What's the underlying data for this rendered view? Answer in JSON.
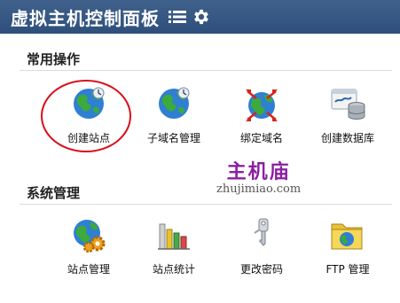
{
  "header": {
    "title": "虚拟主机控制面板",
    "menu_icon": "menu-icon",
    "settings_icon": "gear-icon",
    "background_color": "#34557f"
  },
  "sections": [
    {
      "title": "常用操作",
      "items": [
        {
          "label": "创建站点",
          "icon": "globe-icon"
        },
        {
          "label": "子域名管理",
          "icon": "globe-icon"
        },
        {
          "label": "绑定域名",
          "icon": "globe-arrows-icon"
        },
        {
          "label": "创建数据库",
          "icon": "mysql-database-icon"
        }
      ]
    },
    {
      "title": "系统管理",
      "items": [
        {
          "label": "站点管理",
          "icon": "globe-gears-icon"
        },
        {
          "label": "站点统计",
          "icon": "bar-chart-icon"
        },
        {
          "label": "更改密码",
          "icon": "key-icon"
        },
        {
          "label": "FTP 管理",
          "icon": "folder-globe-icon"
        }
      ]
    }
  ],
  "highlight": {
    "color": "#d90f1b"
  },
  "watermark": {
    "chinese": "主机庙",
    "url": "zhujimiao.com"
  }
}
